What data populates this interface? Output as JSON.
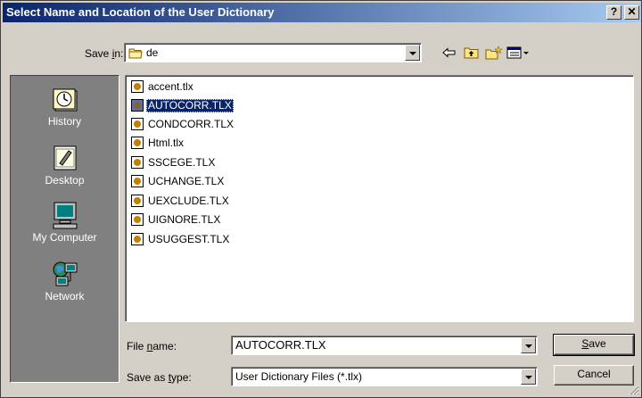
{
  "window": {
    "title": "Select Name and Location of the User Dictionary",
    "help_label": "?",
    "close_label": "✕"
  },
  "save_in": {
    "label_pre": "Save ",
    "label_ul": "i",
    "label_post": "n:",
    "value": "de"
  },
  "toolbar": {
    "icons": [
      "back-icon",
      "up-one-level-icon",
      "create-new-folder-icon",
      "views-menu-icon"
    ]
  },
  "places": [
    {
      "label": "History",
      "icon": "history-icon"
    },
    {
      "label": "Desktop",
      "icon": "desktop-icon"
    },
    {
      "label": "My Computer",
      "icon": "my-computer-icon"
    },
    {
      "label": "Network",
      "icon": "network-icon"
    }
  ],
  "files": [
    {
      "name": "accent.tlx",
      "selected": false
    },
    {
      "name": "AUTOCORR.TLX",
      "selected": true
    },
    {
      "name": "CONDCORR.TLX",
      "selected": false
    },
    {
      "name": "Html.tlx",
      "selected": false
    },
    {
      "name": "SSCEGE.TLX",
      "selected": false
    },
    {
      "name": "UCHANGE.TLX",
      "selected": false
    },
    {
      "name": "UEXCLUDE.TLX",
      "selected": false
    },
    {
      "name": "UIGNORE.TLX",
      "selected": false
    },
    {
      "name": "USUGGEST.TLX",
      "selected": false
    }
  ],
  "file_name": {
    "label_pre": "File ",
    "label_ul": "n",
    "label_post": "ame:",
    "value": "AUTOCORR.TLX"
  },
  "save_as_type": {
    "label_pre": "Save as ",
    "label_ul": "t",
    "label_post": "ype:",
    "value": "User Dictionary Files (*.tlx)"
  },
  "buttons": {
    "save_ul": "S",
    "save_rest": "ave",
    "cancel": "Cancel"
  }
}
